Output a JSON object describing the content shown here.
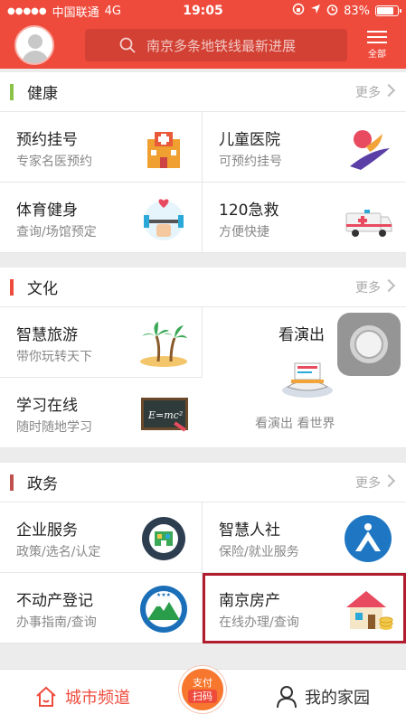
{
  "status_bar": {
    "carrier": "中国联通",
    "network": "4G",
    "time": "19:05",
    "battery": "83%",
    "battery_level": 0.83
  },
  "header": {
    "search_placeholder": "南京多条地铁线最新进展",
    "menu_label": "全部"
  },
  "sections": [
    {
      "title": "健康",
      "more": "更多",
      "accent": "#8bc34a",
      "items": [
        {
          "title": "预约挂号",
          "sub": "专家名医预约",
          "icon": "hospital-icon"
        },
        {
          "title": "儿童医院",
          "sub": "可预约挂号",
          "icon": "child-hospital-icon"
        },
        {
          "title": "体育健身",
          "sub": "查询/场馆预定",
          "icon": "dumbbell-icon"
        },
        {
          "title": "120急救",
          "sub": "方便快捷",
          "icon": "ambulance-icon"
        }
      ]
    },
    {
      "title": "文化",
      "more": "更多",
      "accent": "#ef4b3c",
      "items": [
        {
          "title": "智慧旅游",
          "sub": "带你玩转天下",
          "icon": "palm-tree-icon"
        },
        {
          "title": "学习在线",
          "sub": "随时随地学习",
          "icon": "blackboard-icon",
          "board_text": "E=mc²"
        },
        {
          "title": "看演出",
          "sub": "看演出  看世界",
          "icon": "theater-icon"
        }
      ]
    },
    {
      "title": "政务",
      "more": "更多",
      "accent": "#c0504d",
      "items": [
        {
          "title": "企业服务",
          "sub": "政策/选名/认定",
          "icon": "gear-building-icon"
        },
        {
          "title": "智慧人社",
          "sub": "保险/就业服务",
          "icon": "social-security-icon"
        },
        {
          "title": "不动产登记",
          "sub": "办事指南/查询",
          "icon": "mountain-emblem-icon"
        },
        {
          "title": "南京房产",
          "sub": "在线办理/查询",
          "icon": "house-icon"
        }
      ]
    }
  ],
  "tabbar": {
    "city": "城市频道",
    "pay_top": "支付",
    "pay_bottom": "扫码",
    "home": "我的家园"
  }
}
